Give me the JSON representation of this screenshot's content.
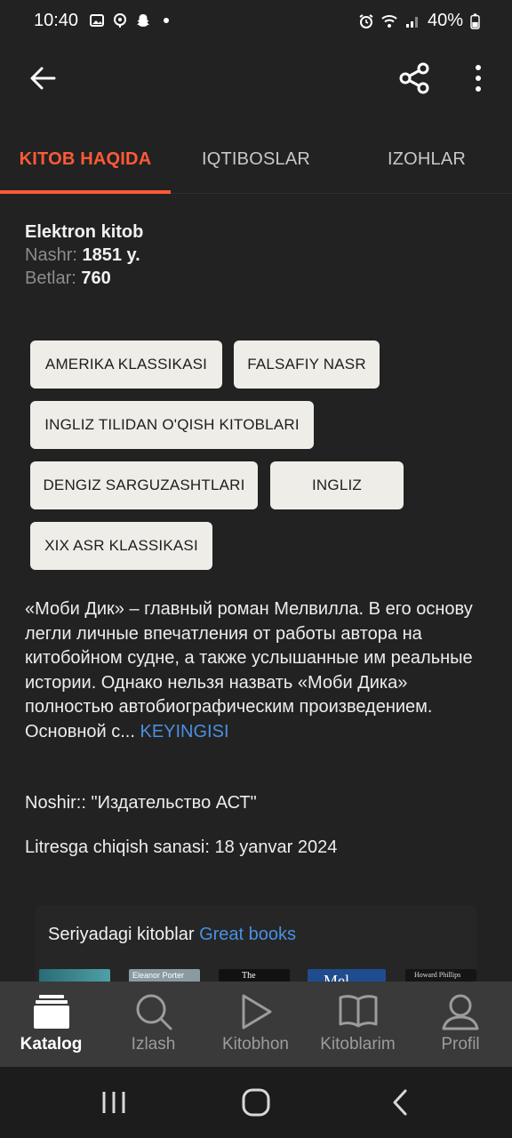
{
  "status_bar": {
    "time": "10:40",
    "battery": "40%",
    "icons_left": [
      "image-icon",
      "location-icon",
      "snapchat-icon",
      "dot-icon"
    ],
    "icons_right": [
      "alarm-icon",
      "wifi-icon",
      "signal-icon",
      "battery-icon"
    ]
  },
  "app_bar": {
    "back_icon": "arrow-left-icon",
    "share_icon": "share-icon",
    "more_icon": "more-vertical-icon"
  },
  "tabs": [
    {
      "label": "KITOB HAQIDA",
      "active": true
    },
    {
      "label": "IQTIBOSLAR",
      "active": false
    },
    {
      "label": "IZOHLAR",
      "active": false
    }
  ],
  "book_info": {
    "type": "Elektron kitob",
    "year_label": "Nashr:",
    "year_value": "1851 y.",
    "pages_label": "Betlar:",
    "pages_value": "760"
  },
  "genres": [
    "AMERIKA KLASSIKASI",
    "FALSAFIY NASR",
    "INGLIZ TILIDAN O'QISH KITOBLARI",
    "DENGIZ SARGUZASHTLARI",
    "INGLIZ",
    "XIX ASR KLASSIKASI"
  ],
  "description": {
    "text": "«Моби Дик» – главный роман Мелвилла. В его основу легли личные впечатления от работы автора на китобойном судне, а также услышанные им реальные истории. Однако нельзя назвать «Моби Дика» полностью автобиографическим произведением.",
    "truncated": "Основной с...",
    "more_label": "KEYINGISI"
  },
  "publisher": "Noshir:: \"Издательство АСТ\"",
  "release_date": "Litresga chiqish sanasi: 18 yanvar 2024",
  "series": {
    "label": "Seriyadagi kitoblar",
    "name": "Great books",
    "covers": [
      "",
      "Eleanor Porter",
      "The",
      "Mel",
      "Howard Phillips"
    ]
  },
  "bottom_nav": [
    {
      "label": "Katalog",
      "icon": "catalog-icon",
      "active": true
    },
    {
      "label": "Izlash",
      "icon": "search-icon",
      "active": false
    },
    {
      "label": "Kitobhon",
      "icon": "play-icon",
      "active": false
    },
    {
      "label": "Kitoblarim",
      "icon": "book-icon",
      "active": false
    },
    {
      "label": "Profil",
      "icon": "profile-icon",
      "active": false
    }
  ],
  "colors": {
    "accent": "#ff5a36",
    "link": "#4a90e2",
    "background": "#222222",
    "chip_bg": "#efede8"
  }
}
